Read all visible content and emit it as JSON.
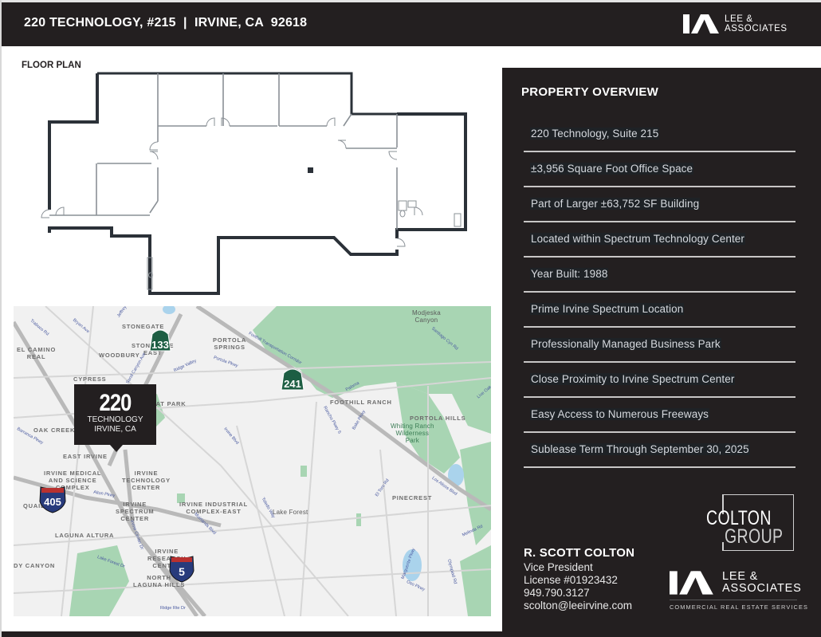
{
  "header": {
    "title": "220 TECHNOLOGY, #215  |  IRVINE, CA  92618",
    "logo": {
      "icon": "lee-associates-logo-icon",
      "line1": "LEE &",
      "line2": "ASSOCIATES"
    }
  },
  "floor_plan": {
    "label": "FLOOR PLAN"
  },
  "map": {
    "pin": {
      "number": "220",
      "line1": "TECHNOLOGY",
      "line2": "IRVINE, CA"
    },
    "shields": [
      {
        "type": "california",
        "number": "133"
      },
      {
        "type": "california",
        "number": "241"
      },
      {
        "type": "interstate",
        "number": "405"
      },
      {
        "type": "interstate",
        "number": "5"
      }
    ],
    "areas": [
      "STONEGATE",
      "STONEGATE\nEAST",
      "EL CAMINO\nREAL",
      "WOODBURY",
      "PORTOLA\nSPRINGS",
      "CYPRESS\nVILLAGE",
      "GREAT PARK",
      "OAK CREEK",
      "EAST IRVINE",
      "IRVINE MEDICAL\nAND SCIENCE\nCOMPLEX",
      "IRVINE\nTECHNOLOGY\nCENTER",
      "IRVINE\nSPECTRUM\nCENTER",
      "QUAIL",
      "LAGUNA ALTURA",
      "IRVINE INDUSTRIAL\nCOMPLEX-EAST",
      "IRVINE\nRESEARCH\nCENTER",
      "NORTH\nLAGUNA HILLS",
      "DY CANYON",
      "FOOTHILL RANCH",
      "PORTOLA HILLS",
      "PINECREST"
    ],
    "places": [
      "Modjeska\nCanyon",
      "Lake Forest"
    ],
    "parks": [
      "Whiting Ranch\nWilderness\nPark"
    ],
    "roads": [
      "Jeffrey",
      "Trabuco Rd",
      "Bryan Ave",
      "Sand Canyon Ave",
      "Ridge Valley",
      "Portola Pkwy",
      "Foothill Transportation Corridor",
      "Paloma",
      "Santiago Cyn Rd",
      "Bake Pkwy",
      "Rancho Pkwy S",
      "Alton Pkwy",
      "Irvine Center Dr",
      "Muirlands Blvd",
      "Lake Forest Dr",
      "Ridge Rte Dr",
      "El Toro Rd",
      "Los Alisos Blvd",
      "Melinda Rd",
      "Marguerite Pkwy",
      "Oso Pkwy",
      "Olympiad Rd",
      "Live Oak",
      "Irvine Blvd",
      "Toledo Way",
      "Barranca Pkwy"
    ]
  },
  "overview": {
    "title": "PROPERTY OVERVIEW",
    "items": [
      "220 Technology, Suite 215",
      "±3,956 Square Foot Office Space",
      "Part of Larger ±63,752 SF Building",
      "Located within Spectrum Technology Center",
      "Year Built: 1988",
      "Prime Irvine Spectrum Location",
      "Professionally Managed Business Park",
      "Close Proximity to Irvine Spectrum Center",
      "Easy Access to Numerous Freeways",
      "Sublease Term Through September 30, 2025"
    ]
  },
  "colton_group": {
    "line1": "COLTON",
    "line2": "GROUP"
  },
  "contact": {
    "name": "R. SCOTT COLTON",
    "title": "Vice President",
    "license": "License #01923432",
    "phone": "949.790.3127",
    "email": "scolton@leeirvine.com"
  },
  "footer_logo": {
    "line1": "LEE &",
    "line2": "ASSOCIATES",
    "tagline": "COMMERCIAL REAL ESTATE SERVICES"
  },
  "colors": {
    "dark": "#231f20",
    "map_bg": "#f1f1f1",
    "park_green": "#a8d5b3",
    "water": "#aad3ec",
    "shield_green": "#1d5e43",
    "interstate_blue": "#283b7c",
    "interstate_red": "#b8312f"
  }
}
